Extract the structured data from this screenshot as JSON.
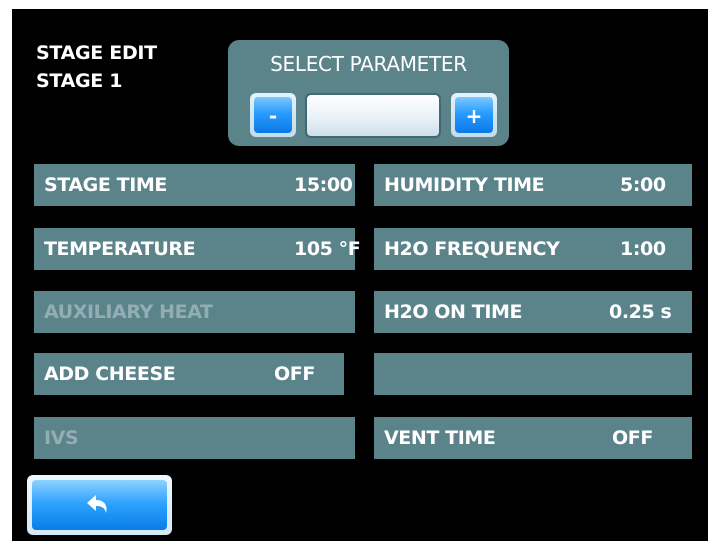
{
  "header": {
    "line1": "STAGE EDIT",
    "line2": "STAGE 1"
  },
  "select_parameter": {
    "label": "SELECT PARAMETER",
    "decrement_label": "-",
    "increment_label": "+",
    "value": ""
  },
  "parameters": {
    "left": [
      {
        "label": "STAGE TIME",
        "value": "15:00",
        "enabled": true
      },
      {
        "label": "TEMPERATURE",
        "value": "105 °F",
        "enabled": true
      },
      {
        "label": "AUXILIARY HEAT",
        "value": "",
        "enabled": false
      },
      {
        "label": "ADD CHEESE",
        "value": "OFF",
        "enabled": true
      },
      {
        "label": "IVS",
        "value": "",
        "enabled": false
      }
    ],
    "right": [
      {
        "label": "HUMIDITY TIME",
        "value": "5:00",
        "enabled": true
      },
      {
        "label": "H2O FREQUENCY",
        "value": "1:00",
        "enabled": true
      },
      {
        "label": "H2O ON TIME",
        "value": "0.25 s",
        "enabled": true
      },
      {
        "label": "",
        "value": "",
        "enabled": true
      },
      {
        "label": "VENT TIME",
        "value": "OFF",
        "enabled": true
      }
    ]
  },
  "back_button": {
    "icon": "back-arrow-icon"
  },
  "colors": {
    "background": "#000000",
    "panel": "#5a838a",
    "disabled_text": "#93aeb3",
    "button_blue": "#1e90ff"
  }
}
